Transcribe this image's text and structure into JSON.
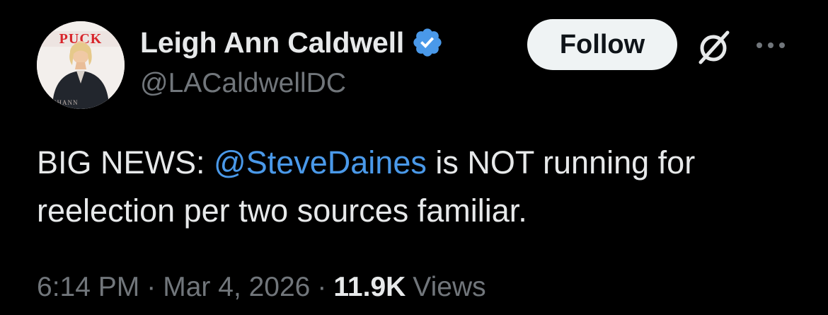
{
  "author": {
    "display_name": "Leigh Ann Caldwell",
    "handle": "@LACaldwellDC",
    "verified_color": "#4a99e9",
    "avatar_backdrop_text": "PUCK",
    "avatar_caption_text": "CHANN"
  },
  "header": {
    "follow_label": "Follow",
    "grok_icon": "grok-icon",
    "more_icon": "more-icon"
  },
  "tweet": {
    "text_before": "BIG NEWS: ",
    "mention": "@SteveDaines",
    "text_after": " is NOT running for reelection per two sources familiar."
  },
  "meta": {
    "time": "6:14 PM",
    "separator_1": "·",
    "date": "Mar 4, 2026",
    "separator_2": "·",
    "views_count": "11.9K",
    "views_label": "Views"
  },
  "colors": {
    "background": "#000000",
    "text_primary": "#e7e9ea",
    "text_secondary": "#71767b",
    "link": "#4a99e9",
    "follow_bg": "#eff3f4"
  }
}
